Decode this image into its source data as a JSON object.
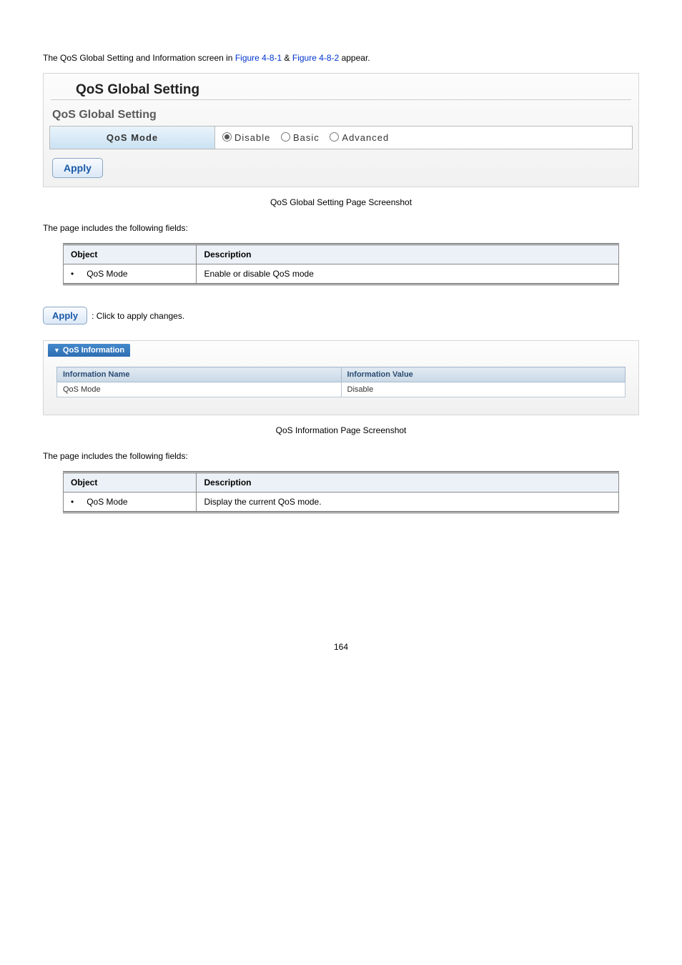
{
  "intro": {
    "prefix": "The QoS Global Setting and Information screen in ",
    "link1": "Figure 4-8-1",
    "amp": " & ",
    "link2": "Figure 4-8-2",
    "suffix": " appear."
  },
  "scr1": {
    "title": "QoS Global Setting",
    "subtitle": "QoS Global Setting",
    "row_label": "QoS Mode",
    "options": {
      "disable": "Disable",
      "basic": "Basic",
      "advanced": "Advanced"
    },
    "apply": "Apply",
    "caption": "QoS Global Setting Page Screenshot"
  },
  "fields_intro": "The page includes the following fields:",
  "table1": {
    "head_obj": "Object",
    "head_desc": "Description",
    "row_obj": "QoS Mode",
    "row_desc": "Enable or disable QoS mode"
  },
  "apply_inline": {
    "btn": "Apply",
    "text": ": Click to apply changes."
  },
  "scr2": {
    "bar": "QoS Information",
    "col1": "Information Name",
    "col2": "Information Value",
    "row_name": "QoS Mode",
    "row_value": "Disable",
    "caption": "QoS Information Page Screenshot"
  },
  "table2": {
    "head_obj": "Object",
    "head_desc": "Description",
    "row_obj": "QoS Mode",
    "row_desc": "Display the current QoS mode."
  },
  "page_number": "164"
}
